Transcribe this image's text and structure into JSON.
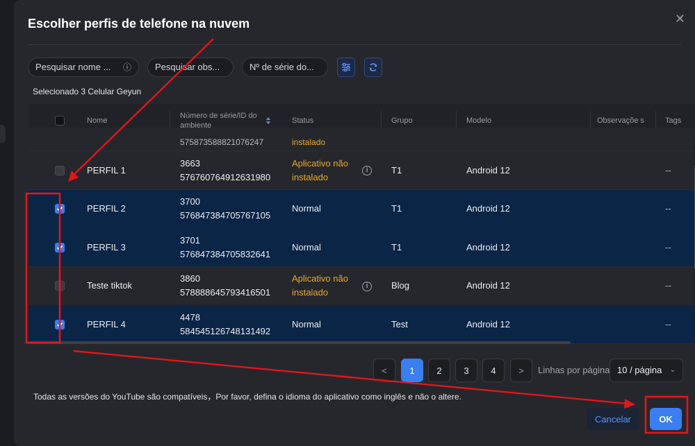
{
  "dialog": {
    "title": "Escolher perfis de telefone na nuvem",
    "close_symbol": "✕"
  },
  "filters": {
    "name_placeholder": "Pesquisar nome ...",
    "obs_placeholder": "Pesquisar obs...",
    "serial_placeholder": "Nº de série do..."
  },
  "selected_info": "Selecionado 3 Celular Geyun",
  "table": {
    "headers": {
      "name": "Nome",
      "serial": "Número de série/ID do ambiente",
      "status": "Status",
      "group": "Grupo",
      "model": "Modelo",
      "notes": "Observaçõe s",
      "tags": "Tags"
    },
    "partial_row": {
      "serial": "575873588821076247",
      "status": "instalado"
    },
    "rows": [
      {
        "checked": false,
        "name": "PERFIL 1",
        "serial_no": "3663",
        "env_id": "576760764912631980",
        "status": "Aplicativo não instalado",
        "warn": true,
        "group": "T1",
        "model": "Android 12",
        "tags": "--"
      },
      {
        "checked": true,
        "name": "PERFIL 2",
        "serial_no": "3700",
        "env_id": "576847384705767105",
        "status": "Normal",
        "warn": false,
        "group": "T1",
        "model": "Android 12",
        "tags": "--"
      },
      {
        "checked": true,
        "name": "PERFIL 3",
        "serial_no": "3701",
        "env_id": "576847384705832641",
        "status": "Normal",
        "warn": false,
        "group": "T1",
        "model": "Android 12",
        "tags": "--"
      },
      {
        "checked": false,
        "name": "Teste tiktok",
        "serial_no": "3860",
        "env_id": "578888645793416501",
        "status": "Aplicativo não instalado",
        "warn": true,
        "group": "Blog",
        "model": "Android 12",
        "tags": "--"
      },
      {
        "checked": true,
        "name": "PERFIL 4",
        "serial_no": "4478",
        "env_id": "584545126748131492",
        "status": "Normal",
        "warn": false,
        "group": "Test",
        "model": "Android 12",
        "tags": "--"
      }
    ]
  },
  "pagination": {
    "pages": [
      "1",
      "2",
      "3",
      "4"
    ],
    "current": "1",
    "prev_symbol": "<",
    "next_symbol": ">",
    "rows_label": "Linhas por página",
    "rows_value": "10 / página"
  },
  "footer_note": "Todas as versões do YouTube são compatíveis，Por favor, defina o idioma do aplicativo como inglês e não o altere.",
  "buttons": {
    "cancel": "Cancelar",
    "ok": "OK"
  },
  "colors": {
    "accent": "#3b7ef0",
    "selected_row": "#0b2547",
    "warning": "#e8a92d",
    "annotation": "#e0161c"
  },
  "annotation": {
    "type": "red arrows and boxes"
  }
}
